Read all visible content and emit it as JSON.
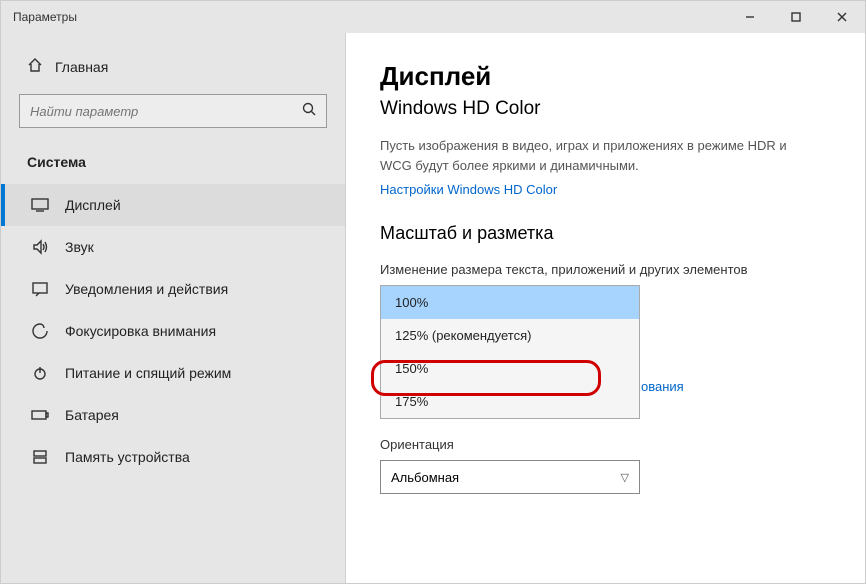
{
  "window": {
    "title": "Параметры"
  },
  "sidebar": {
    "home": "Главная",
    "search_placeholder": "Найти параметр",
    "section": "Система",
    "items": [
      {
        "label": "Дисплей"
      },
      {
        "label": "Звук"
      },
      {
        "label": "Уведомления и действия"
      },
      {
        "label": "Фокусировка внимания"
      },
      {
        "label": "Питание и спящий режим"
      },
      {
        "label": "Батарея"
      },
      {
        "label": "Память устройства"
      }
    ]
  },
  "main": {
    "title": "Дисплей",
    "subtitle": "Windows HD Color",
    "hdr_desc": "Пусть изображения в видео, играх и приложениях в режиме HDR и WCG будут более яркими и динамичными.",
    "hdr_link": "Настройки Windows HD Color",
    "scale_heading": "Масштаб и разметка",
    "scale_label": "Изменение размера текста, приложений и других элементов",
    "scale_options": [
      "100%",
      "125% (рекомендуется)",
      "150%",
      "175%"
    ],
    "scale_peek_link": "ования",
    "orientation_label": "Ориентация",
    "orientation_value": "Альбомная"
  }
}
